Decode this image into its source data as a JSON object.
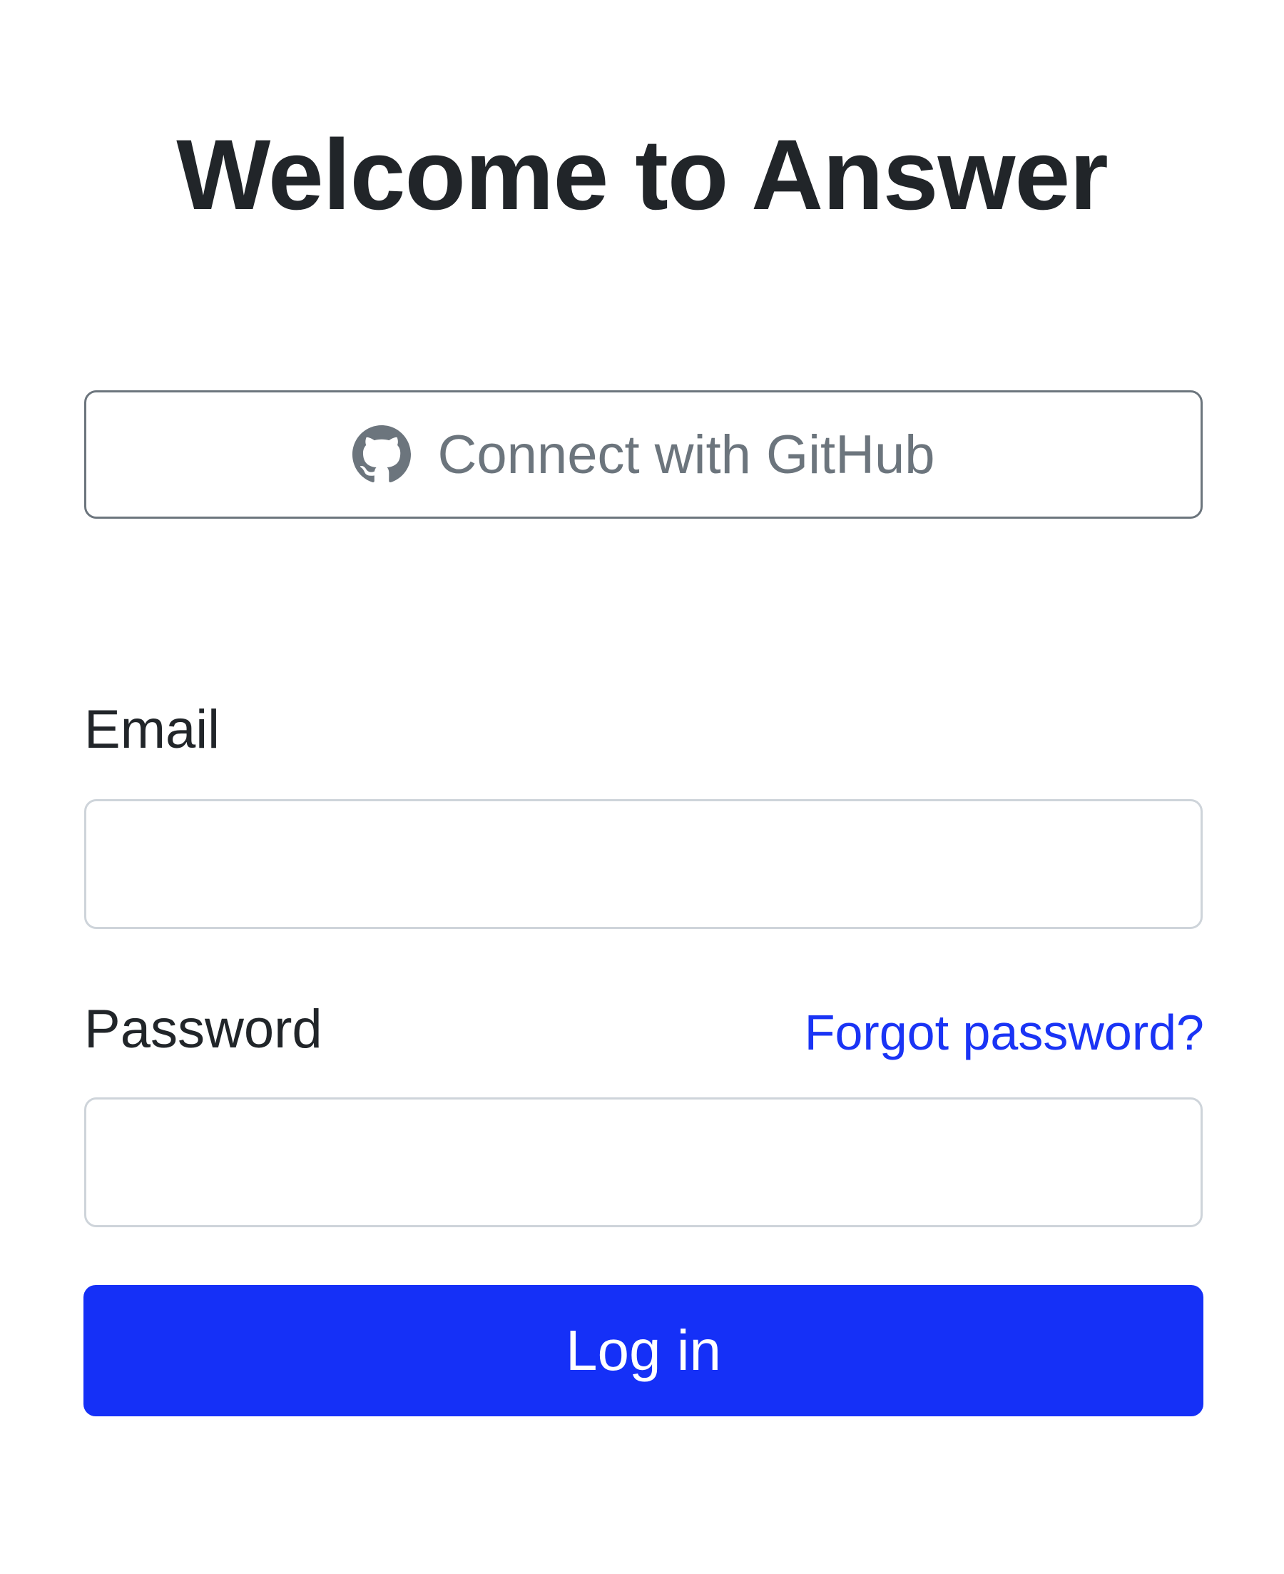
{
  "header": {
    "title": "Welcome to Answer"
  },
  "oauth": {
    "github_label": "Connect with GitHub",
    "icon": "github-icon"
  },
  "form": {
    "email_label": "Email",
    "email_value": "",
    "password_label": "Password",
    "password_value": "",
    "forgot_password_label": "Forgot password?",
    "submit_label": "Log in"
  },
  "colors": {
    "primary": "#1530f7",
    "link": "#1a34f5",
    "secondary": "#6c757d",
    "input_border": "#ced4da",
    "text": "#212529"
  }
}
